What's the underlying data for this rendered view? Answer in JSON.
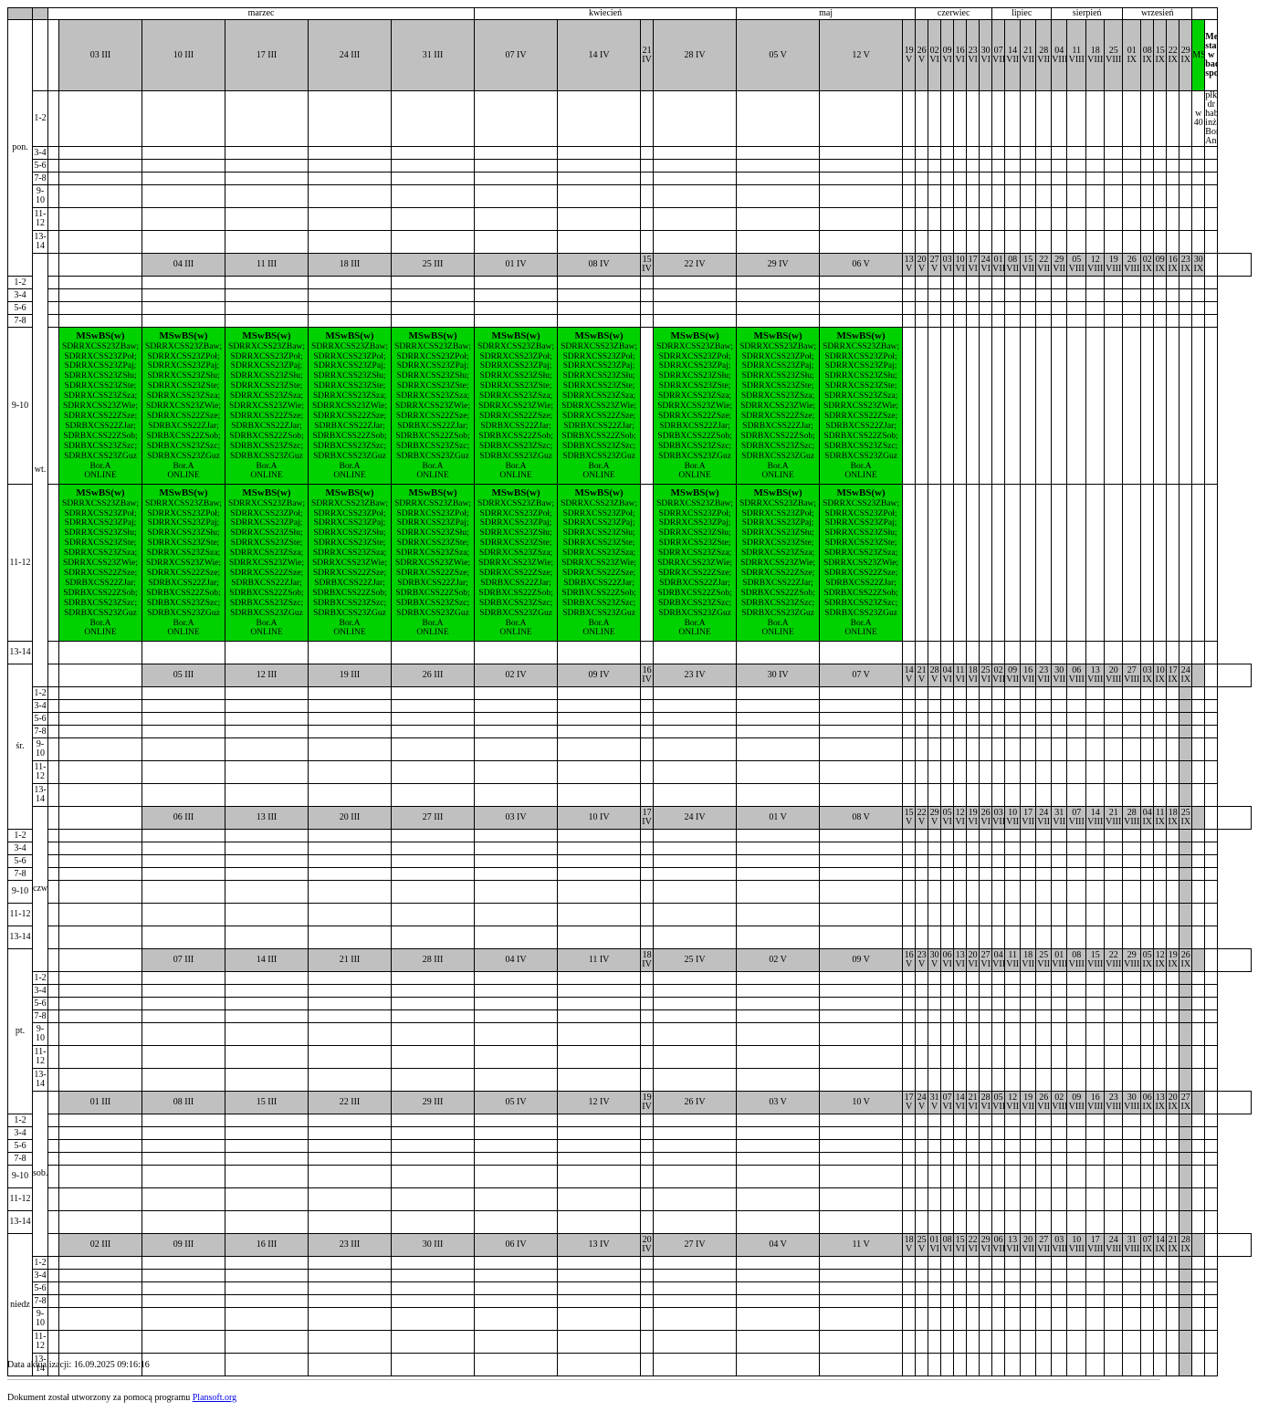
{
  "months": [
    "marzec",
    "kwiecień",
    "maj",
    "czerwiec",
    "lipiec",
    "sierpień",
    "wrzesień"
  ],
  "days": [
    {
      "label": "pon.",
      "dates": [
        "",
        "03 III",
        "10 III",
        "17 III",
        "24 III",
        "31 III",
        "07 IV",
        "14 IV",
        "21 IV",
        "28 IV",
        "05 V",
        "12 V",
        "19 V",
        "26 V",
        "02 VI",
        "09 VI",
        "16 VI",
        "23 VI",
        "30 VI",
        "07 VII",
        "14 VII",
        "21 VII",
        "28 VII",
        "04 VIII",
        "11 VIII",
        "18 VIII",
        "25 VIII",
        "01 IX",
        "08 IX",
        "15 IX",
        "22 IX",
        "29 IX"
      ]
    },
    {
      "label": "wt.",
      "dates": [
        "",
        "04 III",
        "11 III",
        "18 III",
        "25 III",
        "01 IV",
        "08 IV",
        "15 IV",
        "22 IV",
        "29 IV",
        "06 V",
        "13 V",
        "20 V",
        "27 V",
        "03 VI",
        "10 VI",
        "17 VI",
        "24 VI",
        "01 VII",
        "08 VII",
        "15 VII",
        "22 VII",
        "29 VII",
        "05 VIII",
        "12 VIII",
        "19 VIII",
        "26 VIII",
        "02 IX",
        "09 IX",
        "16 IX",
        "23 IX",
        "30 IX"
      ]
    },
    {
      "label": "śr.",
      "dates": [
        "",
        "05 III",
        "12 III",
        "19 III",
        "26 III",
        "02 IV",
        "09 IV",
        "16 IV",
        "23 IV",
        "30 IV",
        "07 V",
        "14 V",
        "21 V",
        "28 V",
        "04 VI",
        "11 VI",
        "18 VI",
        "25 VI",
        "02 VII",
        "09 VII",
        "16 VII",
        "23 VII",
        "30 VII",
        "06 VIII",
        "13 VIII",
        "20 VIII",
        "27 VIII",
        "03 IX",
        "10 IX",
        "17 IX",
        "24 IX",
        ""
      ]
    },
    {
      "label": "czw.",
      "dates": [
        "",
        "06 III",
        "13 III",
        "20 III",
        "27 III",
        "03 IV",
        "10 IV",
        "17 IV",
        "24 IV",
        "01 V",
        "08 V",
        "15 V",
        "22 V",
        "29 V",
        "05 VI",
        "12 VI",
        "19 VI",
        "26 VI",
        "03 VII",
        "10 VII",
        "17 VII",
        "24 VII",
        "31 VII",
        "07 VIII",
        "14 VIII",
        "21 VIII",
        "28 VIII",
        "04 IX",
        "11 IX",
        "18 IX",
        "25 IX",
        ""
      ]
    },
    {
      "label": "pt.",
      "dates": [
        "",
        "07 III",
        "14 III",
        "21 III",
        "28 III",
        "04 IV",
        "11 IV",
        "18 IV",
        "25 IV",
        "02 V",
        "09 V",
        "16 V",
        "23 V",
        "30 V",
        "06 VI",
        "13 VI",
        "20 VI",
        "27 VI",
        "04 VII",
        "11 VII",
        "18 VII",
        "25 VII",
        "01 VIII",
        "08 VIII",
        "15 VIII",
        "22 VIII",
        "29 VIII",
        "05 IX",
        "12 IX",
        "19 IX",
        "26 IX",
        ""
      ]
    },
    {
      "label": "sob.",
      "dates": [
        "01 III",
        "08 III",
        "15 III",
        "22 III",
        "29 III",
        "05 IV",
        "12 IV",
        "19 IV",
        "26 IV",
        "03 V",
        "10 V",
        "17 V",
        "24 V",
        "31 V",
        "07 VI",
        "14 VI",
        "21 VI",
        "28 VI",
        "05 VII",
        "12 VII",
        "19 VII",
        "26 VII",
        "02 VIII",
        "09 VIII",
        "16 VIII",
        "23 VIII",
        "30 VIII",
        "06 IX",
        "13 IX",
        "20 IX",
        "27 IX",
        ""
      ]
    },
    {
      "label": "niedz",
      "dates": [
        "02 III",
        "09 III",
        "16 III",
        "23 III",
        "30 III",
        "06 IV",
        "13 IV",
        "20 IV",
        "27 IV",
        "04 V",
        "11 V",
        "18 V",
        "25 V",
        "01 VI",
        "08 VI",
        "15 VI",
        "22 VI",
        "29 VI",
        "06 VII",
        "13 VII",
        "20 VII",
        "27 VII",
        "03 VIII",
        "10 VIII",
        "17 VIII",
        "24 VIII",
        "31 VIII",
        "07 IX",
        "14 IX",
        "21 IX",
        "28 IX",
        ""
      ]
    }
  ],
  "hours": [
    "1-2",
    "3-4",
    "5-6",
    "7-8",
    "9-10",
    "11-12",
    "13-14"
  ],
  "lesson": {
    "title": "MSwBS(w)",
    "groups": "SDRRXCSS23ZBaw;\nSDRRXCSS23ZPoł;\nSDRRXCSS23ZPaj;\nSDRRXCSS23ZSłu;\nSDRRXCSS23ZSte;\nSDRRXCSS23ZSza;\nSDRRXCSS23ZWie;\nSDRRXCSS22ZSze;\nSDRBXCSS22ZJar;\nSDRBXCSS22ZSob;\nSDRBXCSS23ZSzc;\nSDRBXCSS23ZGuz",
    "teacher": "Bor.A",
    "mode": "ONLINE"
  },
  "legend": {
    "code": "MSwBS",
    "subject": "Metody statystyczne w badaniach społecznych",
    "hours": "w 40",
    "lecturer": "płk dr hab. inż. Borucka Anna",
    "color": "#00d200"
  },
  "footer": {
    "updated": "Data aktualizacji: 16.09.2025 09:16:16",
    "generated": "Dokument został utworzony za pomocą programu",
    "link_text": "Plansoft.org"
  }
}
